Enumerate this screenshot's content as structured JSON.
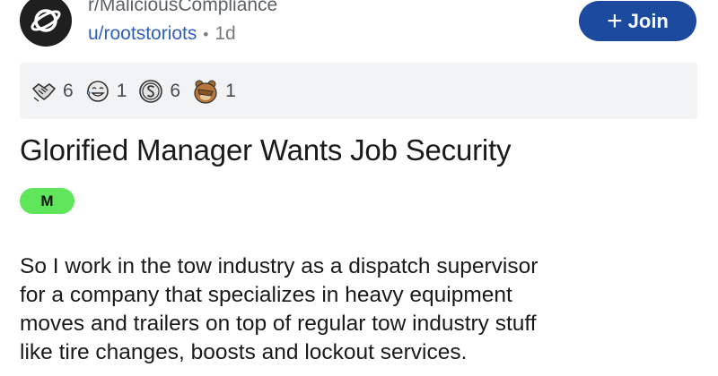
{
  "post": {
    "subreddit": "r/MaliciousCompliance",
    "author": "u/rootstoriots",
    "separator": "•",
    "time": "1d",
    "join_label": "Join",
    "join_icon": "plus-icon",
    "title": "Glorified Manager Wants Job Security",
    "flair": "M",
    "flair_color": "#5fe65a",
    "accent_color": "#1b4a9e",
    "awards": [
      {
        "icon": "handshake-award-icon",
        "count": "6"
      },
      {
        "icon": "tears-of-joy-award-icon",
        "count": "1"
      },
      {
        "icon": "silver-award-icon",
        "count": "6"
      },
      {
        "icon": "facepalm-award-icon",
        "count": "1"
      }
    ],
    "body_lines": [
      "So I work in the tow industry as a dispatch supervisor",
      "for a company that specializes in heavy equipment",
      "moves and trailers on top of regular tow industry stuff",
      "like tire changes, boosts and lockout services."
    ]
  }
}
